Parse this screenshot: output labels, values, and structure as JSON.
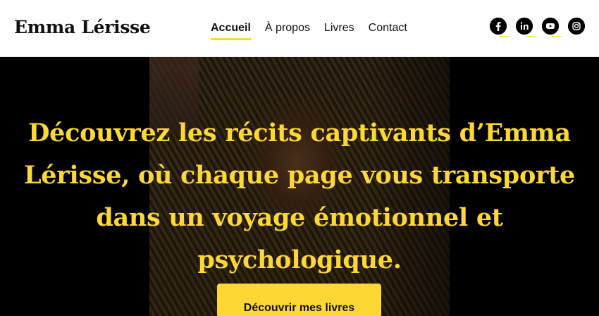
{
  "header": {
    "logo": "Emma Lérisse",
    "nav": [
      {
        "label": "Accueil",
        "active": true
      },
      {
        "label": "À propos",
        "active": false
      },
      {
        "label": "Livres",
        "active": false
      },
      {
        "label": "Contact",
        "active": false
      }
    ],
    "social": [
      {
        "icon": "facebook-icon"
      },
      {
        "icon": "linkedin-icon"
      },
      {
        "icon": "youtube-icon"
      },
      {
        "icon": "instagram-icon"
      }
    ]
  },
  "hero": {
    "title": "Découvrez les récits captivants d’Emma Lérisse, où chaque page vous transporte dans un voyage émotionnel et psychologique.",
    "cta_label": "Découvrir mes livres"
  },
  "colors": {
    "accent": "#fdd835",
    "hero_background": "#000000",
    "header_background": "#ffffff"
  }
}
